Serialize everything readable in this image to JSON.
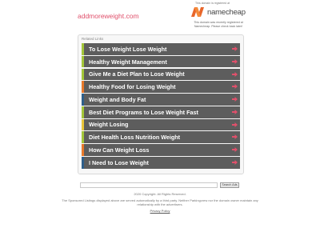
{
  "header": {
    "domain": "addmoreweight.com",
    "registered_note": "This domain is registered at",
    "registrar_name": "namecheap",
    "registrar_desc": "This domain was recently registered at Namecheap. Please check back later!"
  },
  "panel": {
    "title": "Related Links",
    "links": [
      {
        "label": "To Lose Weight Lose Weight",
        "stripe": "#a4c639"
      },
      {
        "label": "Healthy Weight Management",
        "stripe": "#a4c639"
      },
      {
        "label": "Give Me a Diet Plan to Lose Weight",
        "stripe": "#a4c639"
      },
      {
        "label": "Healthy Food for Losing Weight",
        "stripe": "#e8792b"
      },
      {
        "label": "Weight and Body Fat",
        "stripe": "#2f5f8a"
      },
      {
        "label": "Best Diet Programs to Lose Weight Fast",
        "stripe": "#a4c639"
      },
      {
        "label": "Weight Losing",
        "stripe": "#e8c53a"
      },
      {
        "label": "Diet Health Loss Nutrition Weight",
        "stripe": "#a4c639"
      },
      {
        "label": "How Can Weight Loss",
        "stripe": "#e8792b"
      },
      {
        "label": "I Need to Lose Weight",
        "stripe": "#2f5f8a"
      }
    ],
    "arrow_color": "#e0506b"
  },
  "search": {
    "button_label": "Search Ads"
  },
  "footer": {
    "copyright": "2020 Copyright. All Rights Reserved.",
    "disclaimer": "The Sponsored Listings displayed above are served automatically by a third party. Neither Parkingcrew nor the domain owner maintain any relationship with the advertisers.",
    "privacy": "Privacy Policy"
  }
}
